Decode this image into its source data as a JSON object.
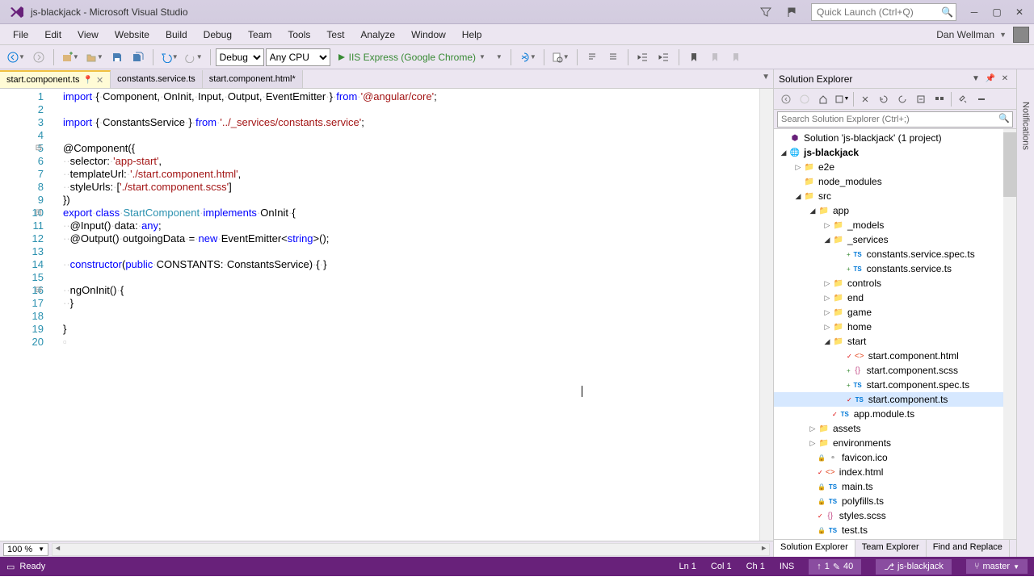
{
  "title": "js-blackjack - Microsoft Visual Studio",
  "quick_launch_placeholder": "Quick Launch (Ctrl+Q)",
  "menu": [
    "File",
    "Edit",
    "View",
    "Website",
    "Build",
    "Debug",
    "Team",
    "Tools",
    "Test",
    "Analyze",
    "Window",
    "Help"
  ],
  "user_name": "Dan Wellman",
  "toolbar": {
    "config": "Debug",
    "platform": "Any CPU",
    "run_label": "IIS Express (Google Chrome)"
  },
  "tabs": [
    {
      "label": "start.component.ts",
      "active": true,
      "pinned": true,
      "dirty": false
    },
    {
      "label": "constants.service.ts",
      "active": false,
      "pinned": false,
      "dirty": false
    },
    {
      "label": "start.component.html*",
      "active": false,
      "pinned": false,
      "dirty": true
    }
  ],
  "code_lines": [
    {
      "n": 1,
      "html": "<span class='kw'>import</span><span class='dot'>·</span>{<span class='dot'>·</span>Component,<span class='dot'>·</span>OnInit,<span class='dot'>·</span>Input,<span class='dot'>·</span>Output,<span class='dot'>·</span>EventEmitter<span class='dot'>·</span>}<span class='dot'>·</span><span class='kw'>from</span><span class='dot'>·</span><span class='str'>'@angular/core'</span>;"
    },
    {
      "n": 2,
      "html": ""
    },
    {
      "n": 3,
      "html": "<span class='kw'>import</span><span class='dot'>·</span>{<span class='dot'>·</span>ConstantsService<span class='dot'>·</span>}<span class='dot'>·</span><span class='kw'>from</span><span class='dot'>·</span><span class='str'>'../_services/constants.service'</span>;"
    },
    {
      "n": 4,
      "html": ""
    },
    {
      "n": 5,
      "html": "@Component({",
      "fold": true
    },
    {
      "n": 6,
      "html": "<span class='dot'>··</span>selector:<span class='dot'>·</span><span class='str'>'app-start'</span>,"
    },
    {
      "n": 7,
      "html": "<span class='dot'>··</span>templateUrl:<span class='dot'>·</span><span class='str'>'./start.component.html'</span>,"
    },
    {
      "n": 8,
      "html": "<span class='dot'>··</span>styleUrls:<span class='dot'>·</span>[<span class='str'>'./start.component.scss'</span>]"
    },
    {
      "n": 9,
      "html": "})"
    },
    {
      "n": 10,
      "html": "<span class='kw'>export</span><span class='dot'>·</span><span class='kw'>class</span><span class='dot'>·</span><span class='type'>StartComponent</span><span class='dot'>·</span><span class='kw'>implements</span><span class='dot'>·</span>OnInit<span class='dot'>·</span>{",
      "fold": true
    },
    {
      "n": 11,
      "html": "<span class='dot'>··</span>@Input()<span class='dot'>·</span>data:<span class='dot'>·</span><span class='kw'>any</span>;"
    },
    {
      "n": 12,
      "html": "<span class='dot'>··</span>@Output()<span class='dot'>·</span>outgoingData<span class='dot'>·</span>=<span class='dot'>·</span><span class='kw'>new</span><span class='dot'>·</span>EventEmitter&lt;<span class='kw'>string</span>&gt;();"
    },
    {
      "n": 13,
      "html": ""
    },
    {
      "n": 14,
      "html": "<span class='dot'>··</span><span class='kw'>constructor</span>(<span class='kw'>public</span><span class='dot'>·</span>CONSTANTS:<span class='dot'>·</span>ConstantsService)<span class='dot'>·</span>{<span class='dot'>·</span>}"
    },
    {
      "n": 15,
      "html": ""
    },
    {
      "n": 16,
      "html": "<span class='dot'>··</span>ngOnInit()<span class='dot'>·</span>{",
      "fold": true
    },
    {
      "n": 17,
      "html": "<span class='dot'>··</span>}"
    },
    {
      "n": 18,
      "html": ""
    },
    {
      "n": 19,
      "html": "}"
    },
    {
      "n": 20,
      "html": "<span style='color:#ccc'>▫</span>"
    }
  ],
  "zoom": "100 %",
  "solution_explorer": {
    "title": "Solution Explorer",
    "search_placeholder": "Search Solution Explorer (Ctrl+;)",
    "tabs": [
      "Solution Explorer",
      "Team Explorer",
      "Find and Replace"
    ]
  },
  "tree": [
    {
      "depth": 0,
      "arrow": "",
      "icon": "sol",
      "label": "Solution 'js-blackjack' (1 project)"
    },
    {
      "depth": 0,
      "arrow": "▾",
      "icon": "globe",
      "label": "js-blackjack",
      "bold": true
    },
    {
      "depth": 1,
      "arrow": "▸",
      "icon": "folder",
      "label": "e2e"
    },
    {
      "depth": 1,
      "arrow": "",
      "icon": "folder",
      "label": "node_modules"
    },
    {
      "depth": 1,
      "arrow": "▾",
      "icon": "folder",
      "label": "src"
    },
    {
      "depth": 2,
      "arrow": "▾",
      "icon": "folder",
      "label": "app"
    },
    {
      "depth": 3,
      "arrow": "▸",
      "icon": "folder",
      "label": "_models"
    },
    {
      "depth": 3,
      "arrow": "▾",
      "icon": "folder",
      "label": "_services"
    },
    {
      "depth": 4,
      "arrow": "",
      "icon": "ts",
      "label": "constants.service.spec.ts",
      "badge": "+"
    },
    {
      "depth": 4,
      "arrow": "",
      "icon": "ts",
      "label": "constants.service.ts",
      "badge": "+"
    },
    {
      "depth": 3,
      "arrow": "▸",
      "icon": "folder",
      "label": "controls"
    },
    {
      "depth": 3,
      "arrow": "▸",
      "icon": "folder",
      "label": "end"
    },
    {
      "depth": 3,
      "arrow": "▸",
      "icon": "folder",
      "label": "game"
    },
    {
      "depth": 3,
      "arrow": "▸",
      "icon": "folder",
      "label": "home"
    },
    {
      "depth": 3,
      "arrow": "▾",
      "icon": "folder",
      "label": "start"
    },
    {
      "depth": 4,
      "arrow": "",
      "icon": "html",
      "label": "start.component.html",
      "badge": "✓"
    },
    {
      "depth": 4,
      "arrow": "",
      "icon": "scss",
      "label": "start.component.scss",
      "badge": "+"
    },
    {
      "depth": 4,
      "arrow": "",
      "icon": "ts",
      "label": "start.component.spec.ts",
      "badge": "+"
    },
    {
      "depth": 4,
      "arrow": "",
      "icon": "ts",
      "label": "start.component.ts",
      "badge": "✓",
      "selected": true
    },
    {
      "depth": 3,
      "arrow": "",
      "icon": "ts",
      "label": "app.module.ts",
      "badge": "✓"
    },
    {
      "depth": 2,
      "arrow": "▸",
      "icon": "folder",
      "label": "assets"
    },
    {
      "depth": 2,
      "arrow": "▸",
      "icon": "folder",
      "label": "environments"
    },
    {
      "depth": 2,
      "arrow": "",
      "icon": "file",
      "label": "favicon.ico",
      "badge": "🔒"
    },
    {
      "depth": 2,
      "arrow": "",
      "icon": "html",
      "label": "index.html",
      "badge": "✓"
    },
    {
      "depth": 2,
      "arrow": "",
      "icon": "ts",
      "label": "main.ts",
      "badge": "🔒"
    },
    {
      "depth": 2,
      "arrow": "",
      "icon": "ts",
      "label": "polyfills.ts",
      "badge": "🔒"
    },
    {
      "depth": 2,
      "arrow": "",
      "icon": "scss",
      "label": "styles.scss",
      "badge": "✓"
    },
    {
      "depth": 2,
      "arrow": "",
      "icon": "ts",
      "label": "test.ts",
      "badge": "🔒"
    }
  ],
  "status": {
    "ready": "Ready",
    "ln": "Ln 1",
    "col": "Col 1",
    "ch": "Ch 1",
    "ins": "INS",
    "changes_up": "1",
    "changes_pen": "40",
    "repo": "js-blackjack",
    "branch": "master"
  },
  "notif_label": "Notifications"
}
